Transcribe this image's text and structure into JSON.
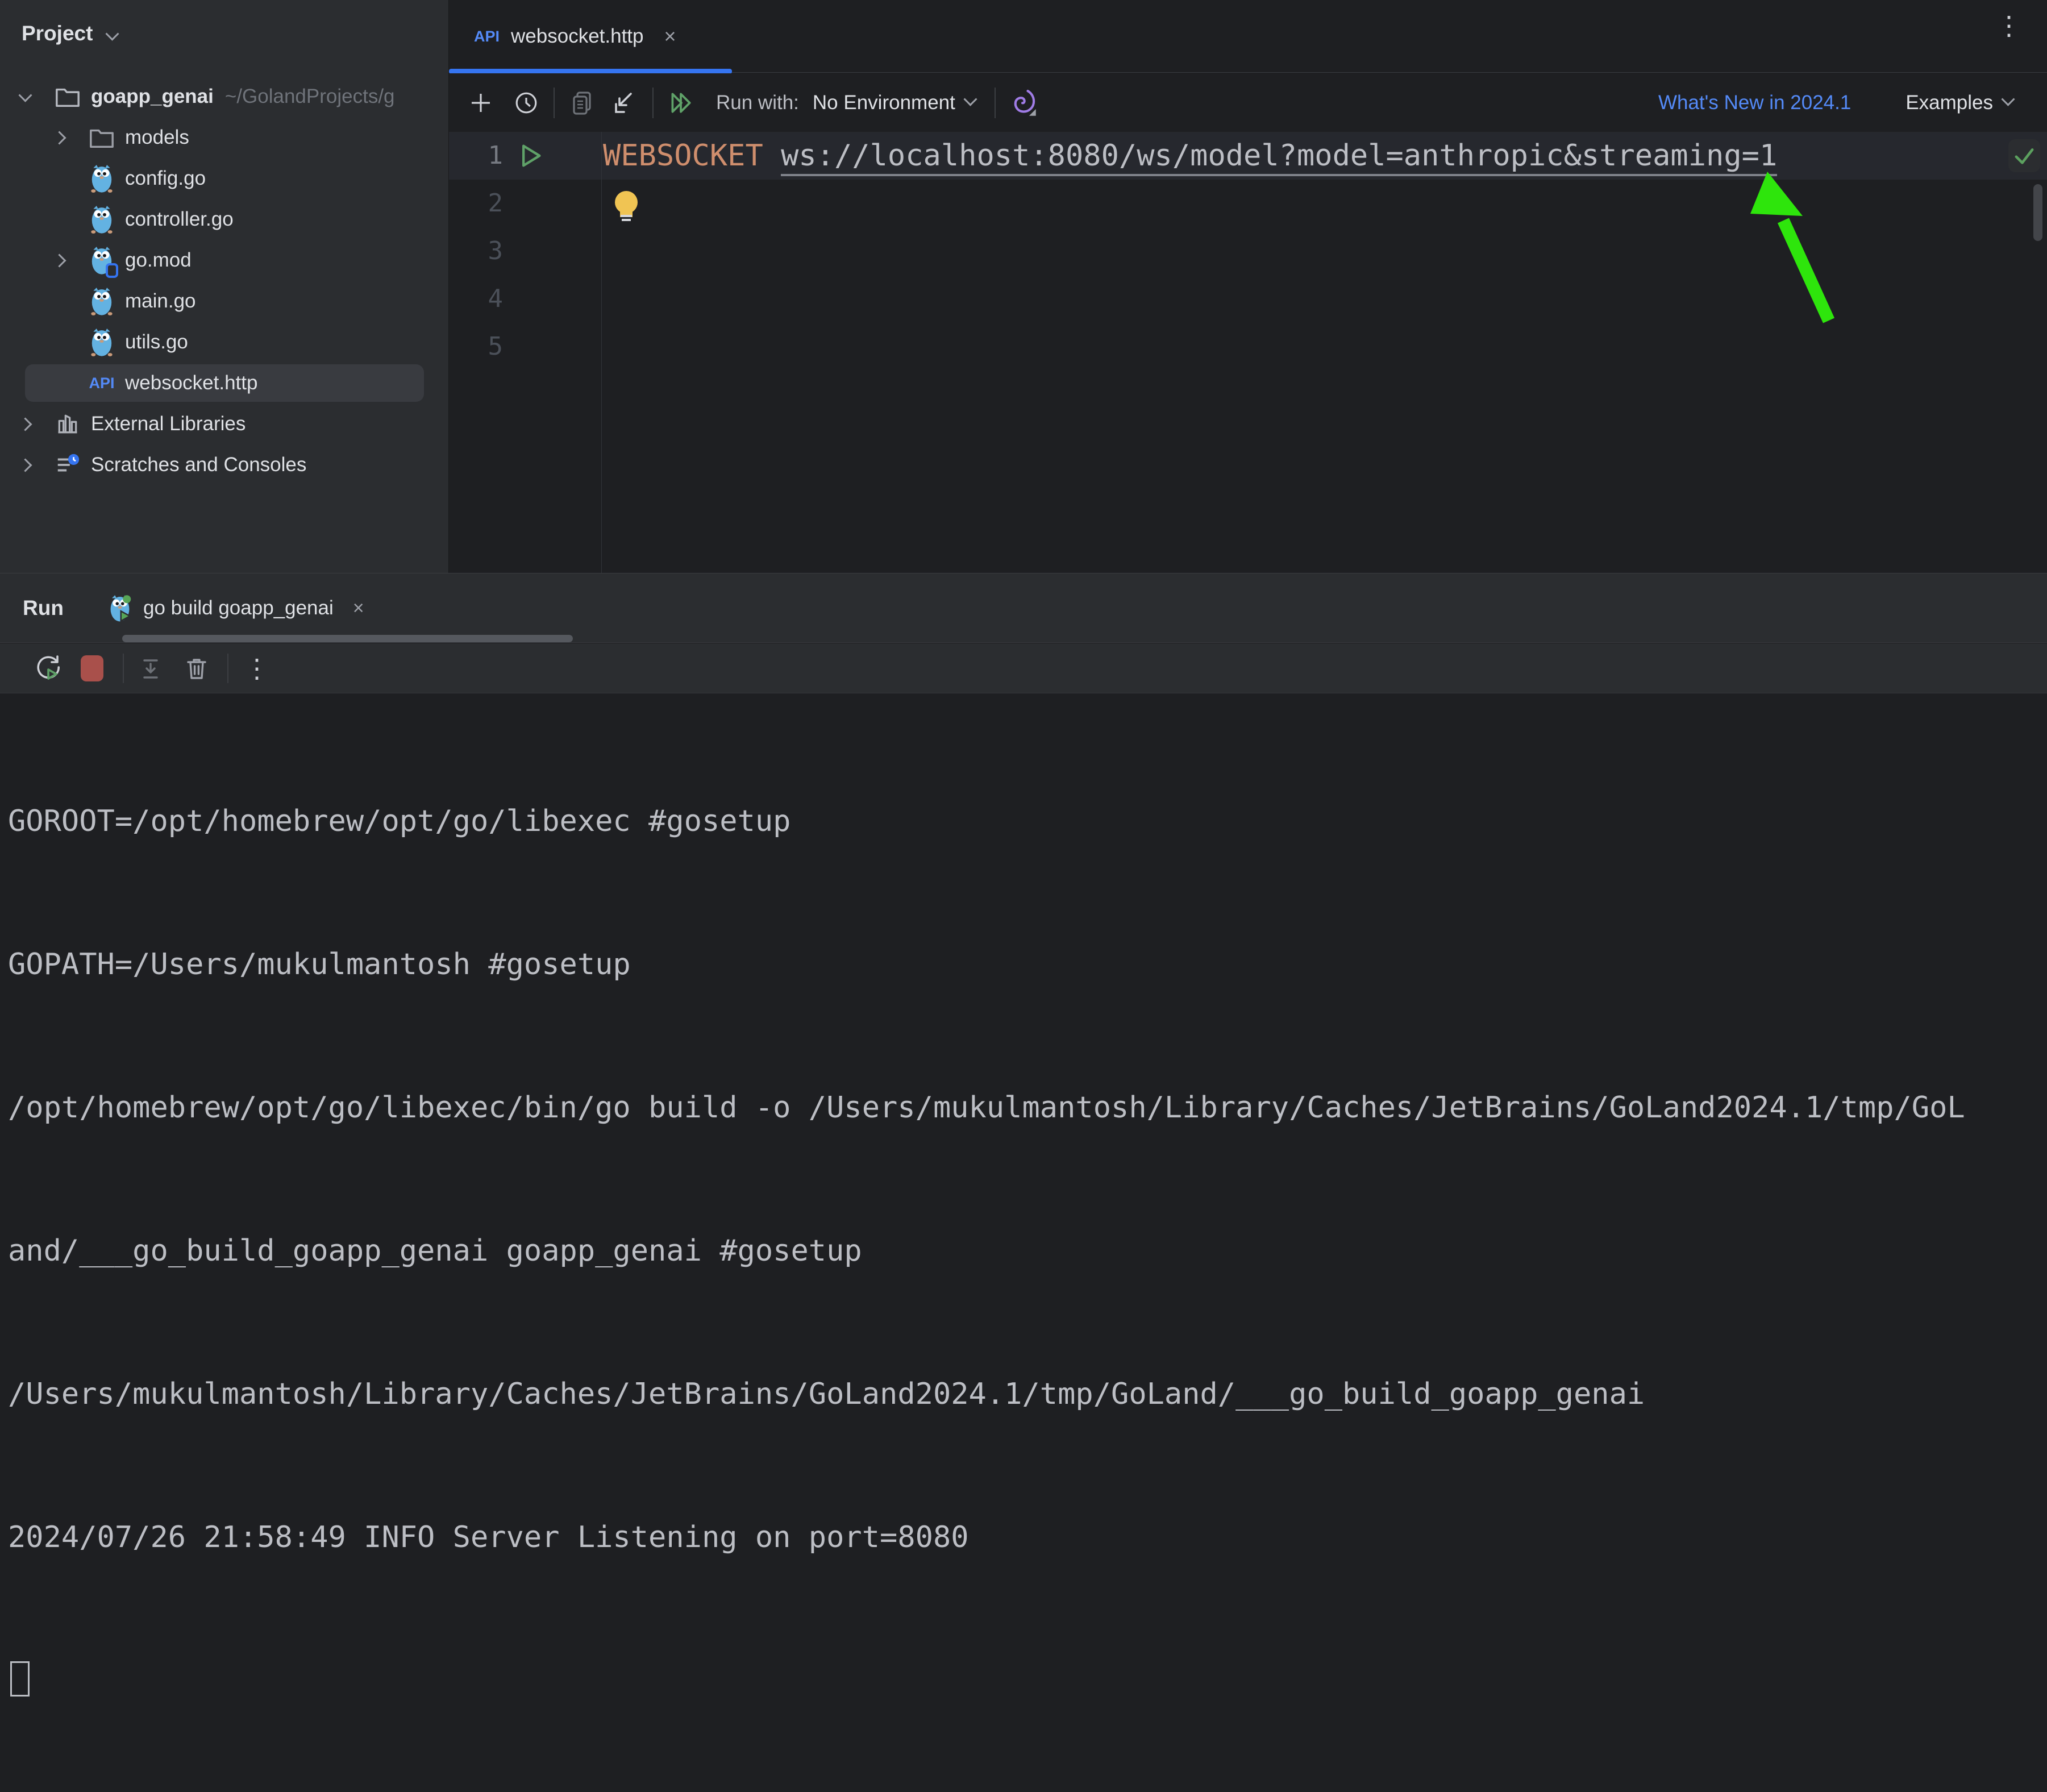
{
  "app": {
    "kebab_menu": "⋮"
  },
  "project_panel": {
    "title": "Project",
    "tree": [
      {
        "label": "goapp_genai",
        "path": "~/GolandProjects/g",
        "type": "project-root",
        "expanded": true
      },
      {
        "label": "models",
        "type": "folder",
        "collapsed": true
      },
      {
        "label": "config.go",
        "type": "go-file"
      },
      {
        "label": "controller.go",
        "type": "go-file"
      },
      {
        "label": "go.mod",
        "type": "go-module",
        "collapsed": true
      },
      {
        "label": "main.go",
        "type": "go-file"
      },
      {
        "label": "utils.go",
        "type": "go-file"
      },
      {
        "label": "websocket.http",
        "type": "http-request-file",
        "badge": "API",
        "selected": true
      },
      {
        "label": "External Libraries",
        "type": "external-libraries",
        "collapsed": true
      },
      {
        "label": "Scratches and Consoles",
        "type": "scratches",
        "collapsed": true
      }
    ]
  },
  "editor": {
    "tab": {
      "badge": "API",
      "title": "websocket.http",
      "close": "×"
    },
    "toolbar": {
      "run_with": "Run with:",
      "environment": "No Environment",
      "whats_new": "What's New in 2024.1",
      "examples": "Examples"
    },
    "gutter": {
      "lines": [
        "1",
        "2",
        "3",
        "4",
        "5"
      ]
    },
    "code": {
      "method": "WEBSOCKET",
      "url": "ws://localhost:8080/ws/model?model=anthropic&streaming=1"
    }
  },
  "run_panel": {
    "title": "Run",
    "tab": {
      "label": "go build goapp_genai",
      "close": "×"
    },
    "console": [
      "GOROOT=/opt/homebrew/opt/go/libexec #gosetup",
      "GOPATH=/Users/mukulmantosh #gosetup",
      "/opt/homebrew/opt/go/libexec/bin/go build -o /Users/mukulmantosh/Library/Caches/JetBrains/GoLand2024.1/tmp/GoL",
      "and/___go_build_goapp_genai goapp_genai #gosetup",
      "/Users/mukulmantosh/Library/Caches/JetBrains/GoLand2024.1/tmp/GoLand/___go_build_goapp_genai",
      "2024/07/26 21:58:49 INFO Server Listening on port=8080"
    ]
  },
  "colors": {
    "accent_blue": "#3574f0",
    "link_blue": "#548af7",
    "keyword_orange": "#cf8e6d",
    "editor_bg": "#1e1f22",
    "panel_bg": "#2b2d30",
    "selection_bg": "#393b40",
    "console_text": "#bcbec4",
    "run_green": "#5fa168",
    "annotation_arrow_green": "#2ee50c",
    "stop_red": "#a9504b",
    "bulb_yellow": "#f0c453"
  }
}
